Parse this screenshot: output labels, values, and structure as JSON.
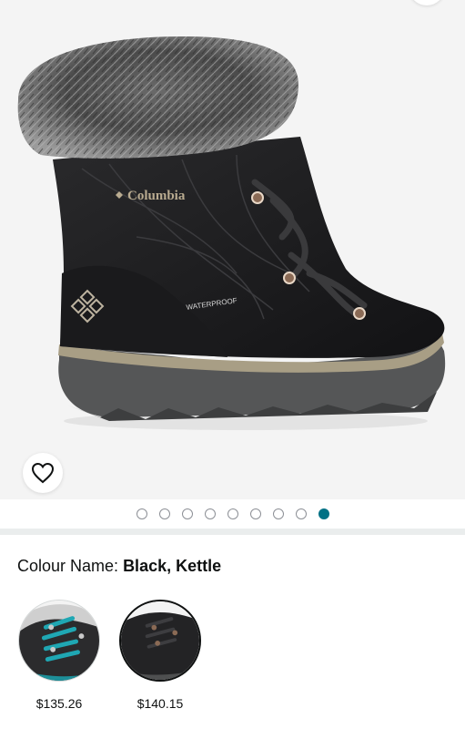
{
  "gallery": {
    "image_count": 9,
    "active_index": 8,
    "brand_text": "Columbia",
    "tag_text": "WATERPROOF",
    "dot_active_color": "#007185"
  },
  "icons": {
    "wishlist": "heart-outline-icon"
  },
  "colour": {
    "label": "Colour Name:",
    "value": "Black, Kettle"
  },
  "swatches": [
    {
      "price": "$135.26",
      "selected": false
    },
    {
      "price": "$140.15",
      "selected": true
    }
  ]
}
